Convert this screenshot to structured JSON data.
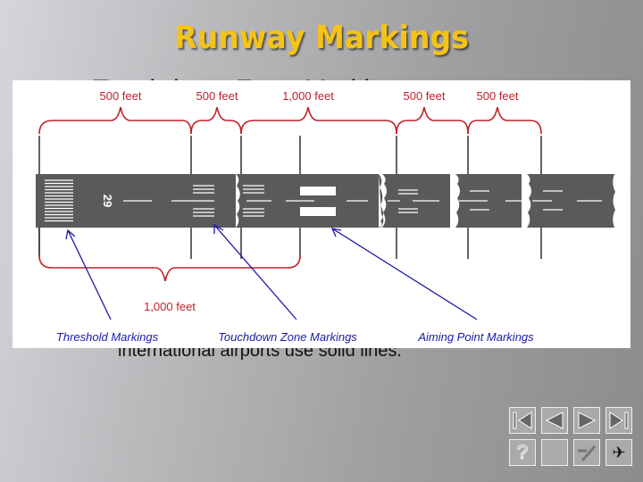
{
  "slide": {
    "title": "Runway Markings",
    "subtitle_partial": "Touchdown Zone Markings",
    "body_partial": "international airports use solid lines."
  },
  "diagram": {
    "runway_number": "29",
    "top_distances": [
      "500 feet",
      "500 feet",
      "1,000 feet",
      "500 feet",
      "500 feet"
    ],
    "bottom_distance": "1,000 feet",
    "callouts": [
      "Threshold Markings",
      "Touchdown Zone Markings",
      "Aiming Point Markings"
    ],
    "colors": {
      "dimension": "#c0202a",
      "callout": "#1a1aa8",
      "runway": "#5a5a5a",
      "marking": "#ffffff"
    }
  },
  "nav": {
    "buttons": [
      {
        "name": "first-slide-button",
        "icon": "first-icon"
      },
      {
        "name": "previous-slide-button",
        "icon": "previous-icon"
      },
      {
        "name": "next-slide-button",
        "icon": "next-icon"
      },
      {
        "name": "last-slide-button",
        "icon": "last-icon"
      },
      {
        "name": "help-button",
        "icon": "help-icon",
        "glyph": "?"
      },
      {
        "name": "blank-button",
        "icon": "blank-icon"
      },
      {
        "name": "return-button",
        "icon": "return-icon"
      },
      {
        "name": "airplane-button",
        "icon": "airplane-icon",
        "glyph": "✈"
      }
    ]
  }
}
